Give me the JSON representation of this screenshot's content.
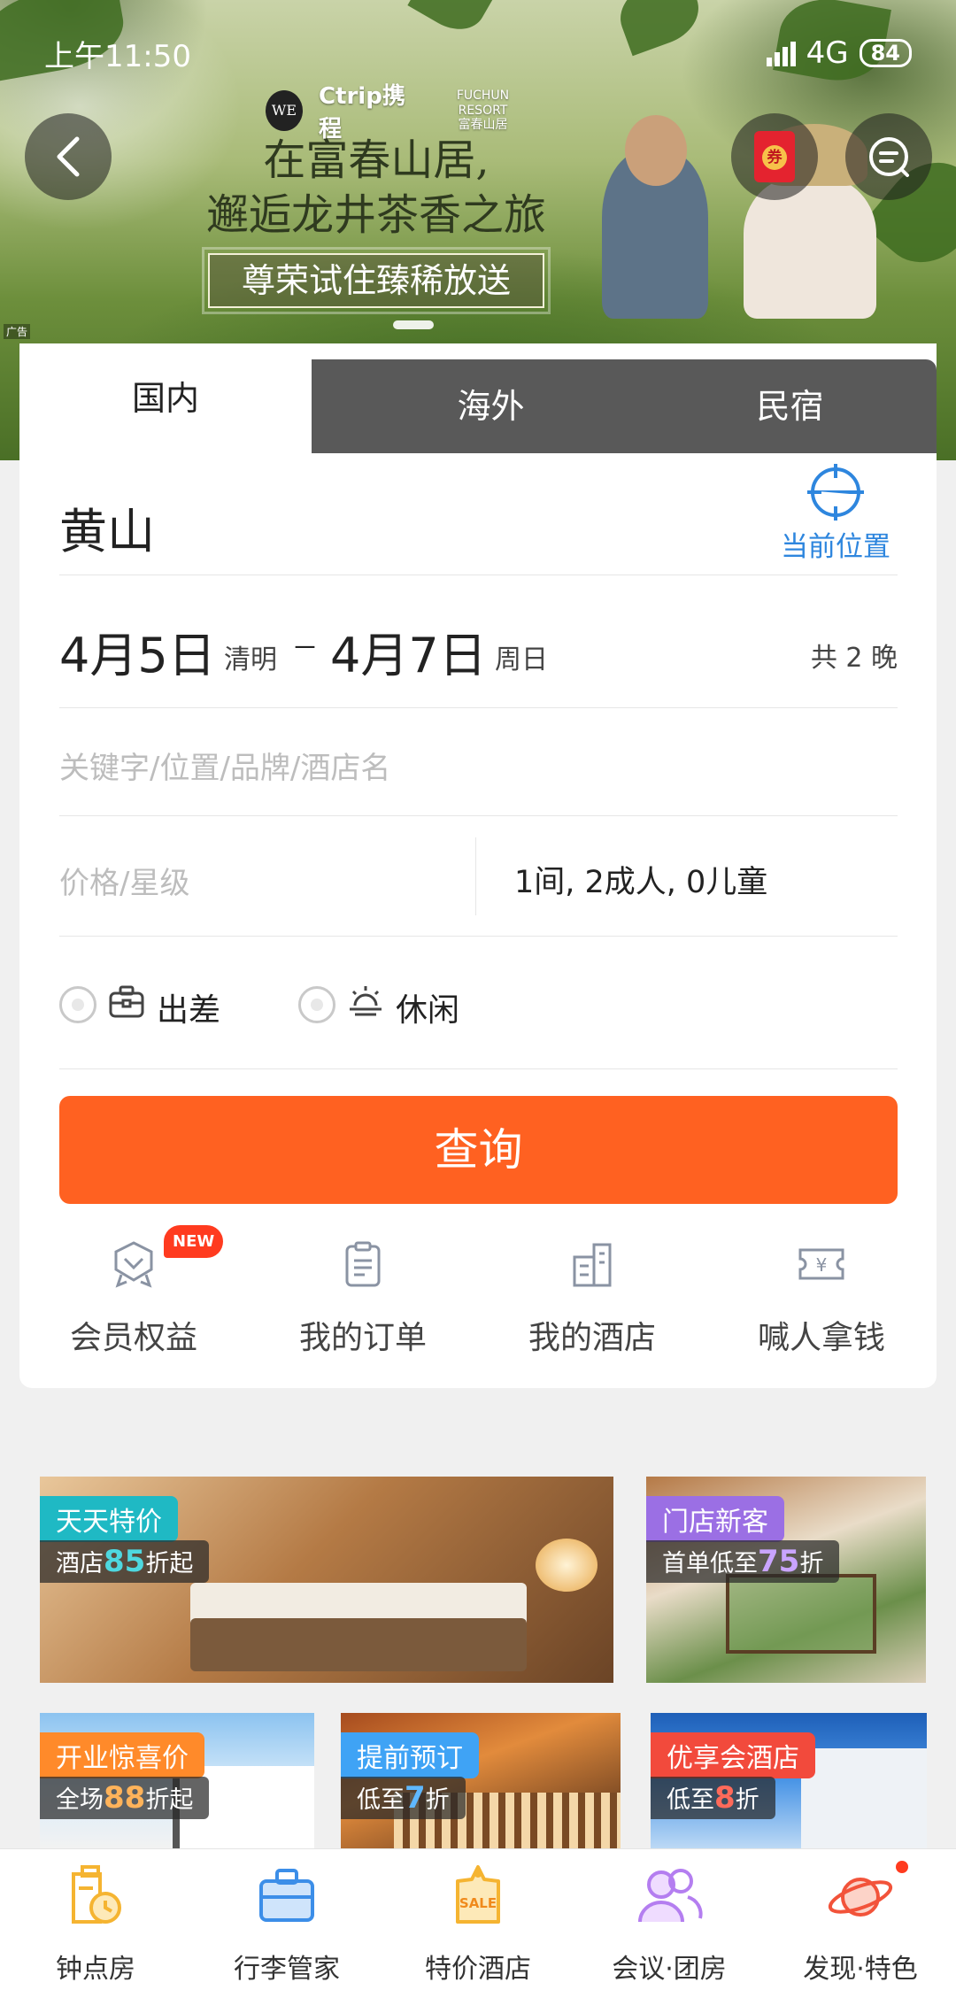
{
  "status_bar": {
    "time": "上午11:50",
    "network": "4G",
    "battery": "84"
  },
  "banner": {
    "logo_left": "WE",
    "logo_ctrip": "Ctrip携程",
    "logo_fuchun": "FUCHUN RESORT\n富春山居",
    "title_line1": "在富春山居,",
    "title_line2": "邂逅龙井茶香之旅",
    "subtitle": "尊荣试住臻稀放送",
    "ad_tag": "广告",
    "coupon_label": "券"
  },
  "tabs": [
    "国内",
    "海外",
    "民宿"
  ],
  "search": {
    "city": "黄山",
    "locate_label": "当前位置",
    "check_in": "4月5日",
    "check_in_note": "清明",
    "dash": "–",
    "check_out": "4月7日",
    "check_out_note": "周日",
    "nights": "共 2 晚",
    "keyword_placeholder": "关键字/位置/品牌/酒店名",
    "price_placeholder": "价格/星级",
    "guests": "1间, 2成人, 0儿童",
    "purpose_business": "出差",
    "purpose_leisure": "休闲",
    "button": "查询"
  },
  "quick_links": [
    {
      "label": "会员权益",
      "icon": "member-badge-icon"
    },
    {
      "label": "我的订单",
      "icon": "order-clipboard-icon"
    },
    {
      "label": "我的酒店",
      "icon": "hotel-building-icon"
    },
    {
      "label": "喊人拿钱",
      "icon": "yen-ticket-icon"
    }
  ],
  "new_badge": "NEW",
  "promos": [
    {
      "tag": "天天特价",
      "sub_pre": "酒店",
      "sub_num": "85",
      "sub_post": "折起",
      "tag_color": "#1fb9c4"
    },
    {
      "tag": "门店新客",
      "sub_pre": "首单低至",
      "sub_num": "75",
      "sub_post": "折",
      "tag_color": "#9b6fe4"
    },
    {
      "tag": "开业惊喜价",
      "sub_pre": "全场",
      "sub_num": "88",
      "sub_post": "折起",
      "tag_color": "#ff8a2a"
    },
    {
      "tag": "提前预订",
      "sub_pre": "低至",
      "sub_num": "7",
      "sub_post": "折",
      "tag_color": "#3fa3f5"
    },
    {
      "tag": "优享会酒店",
      "sub_pre": "低至",
      "sub_num": "8",
      "sub_post": "折",
      "tag_color": "#f24a3c"
    }
  ],
  "bottom_nav": [
    {
      "label": "钟点房",
      "icon": "hourly-room-icon"
    },
    {
      "label": "行李管家",
      "icon": "luggage-icon"
    },
    {
      "label": "特价酒店",
      "icon": "sale-tag-icon",
      "icon_text": "SALE"
    },
    {
      "label": "会议·团房",
      "icon": "meeting-group-icon"
    },
    {
      "label": "发现·特色",
      "icon": "planet-discover-icon"
    }
  ],
  "colors": {
    "accent_orange": "#ff6121",
    "link_blue": "#2e86de",
    "badge_red": "#ff3b1f"
  }
}
